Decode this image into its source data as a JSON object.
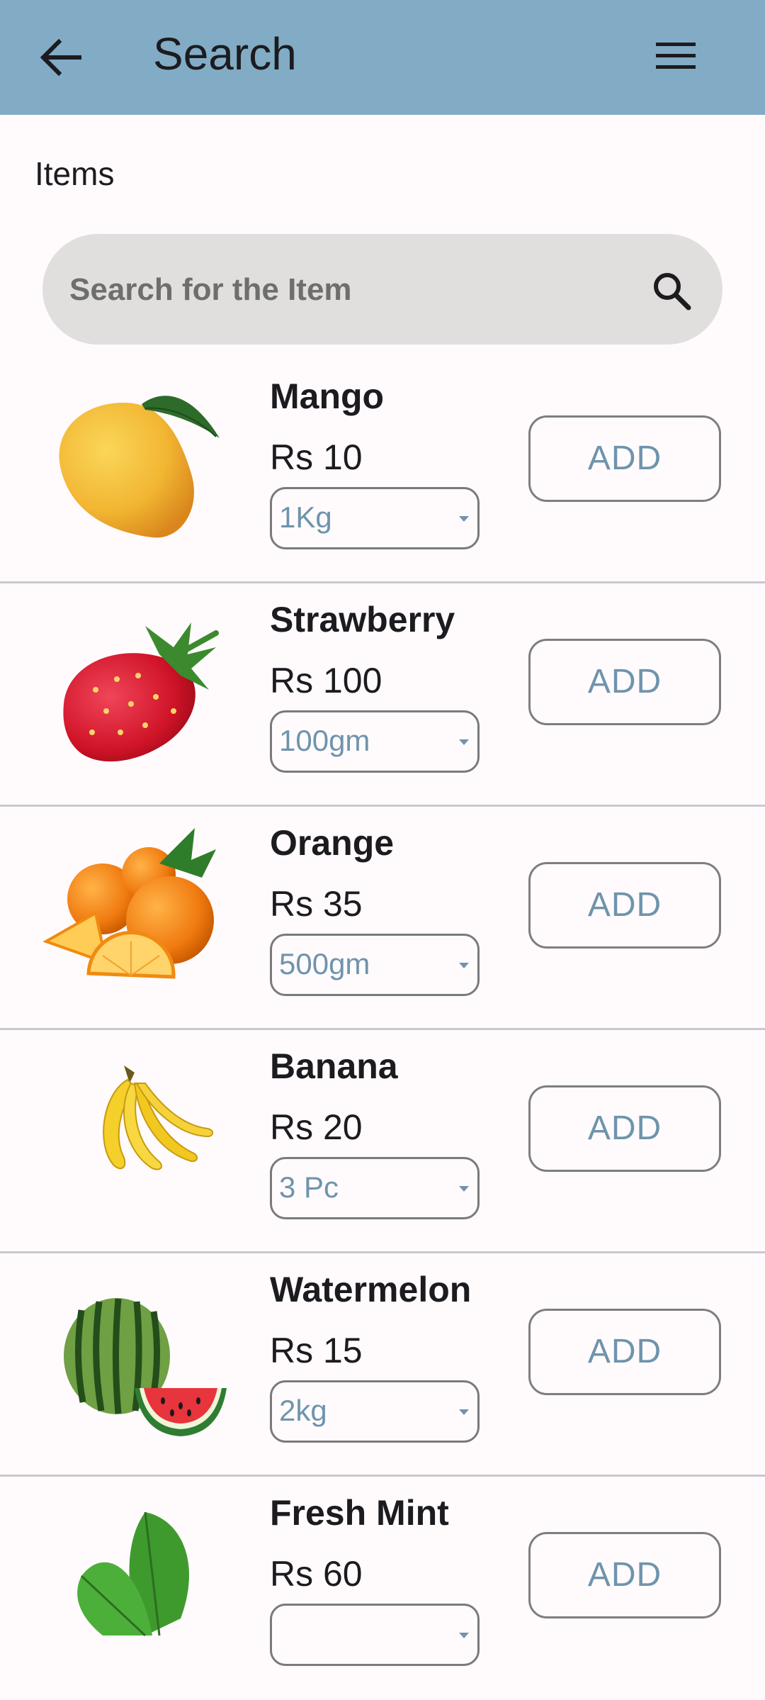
{
  "appbar": {
    "title": "Search",
    "back_icon": "arrow-left-icon",
    "menu_icon": "hamburger-menu-icon",
    "color": "#82acc5"
  },
  "section": {
    "label": "Items"
  },
  "search": {
    "placeholder": "Search for the Item",
    "value": "",
    "icon": "search-icon"
  },
  "items": [
    {
      "name": "Mango",
      "price": "Rs 10",
      "unit": "1Kg",
      "button": "ADD",
      "image": "mango"
    },
    {
      "name": "Strawberry",
      "price": "Rs 100",
      "unit": "100gm",
      "button": "ADD",
      "image": "strawberry"
    },
    {
      "name": "Orange",
      "price": "Rs 35",
      "unit": "500gm",
      "button": "ADD",
      "image": "orange"
    },
    {
      "name": "Banana",
      "price": "Rs 20",
      "unit": "3 Pc",
      "button": "ADD",
      "image": "banana"
    },
    {
      "name": "Watermelon",
      "price": "Rs 15",
      "unit": "2kg",
      "button": "ADD",
      "image": "watermelon"
    },
    {
      "name": "Fresh Mint",
      "price": "Rs 60",
      "unit": "",
      "button": "ADD",
      "image": "mint"
    }
  ]
}
